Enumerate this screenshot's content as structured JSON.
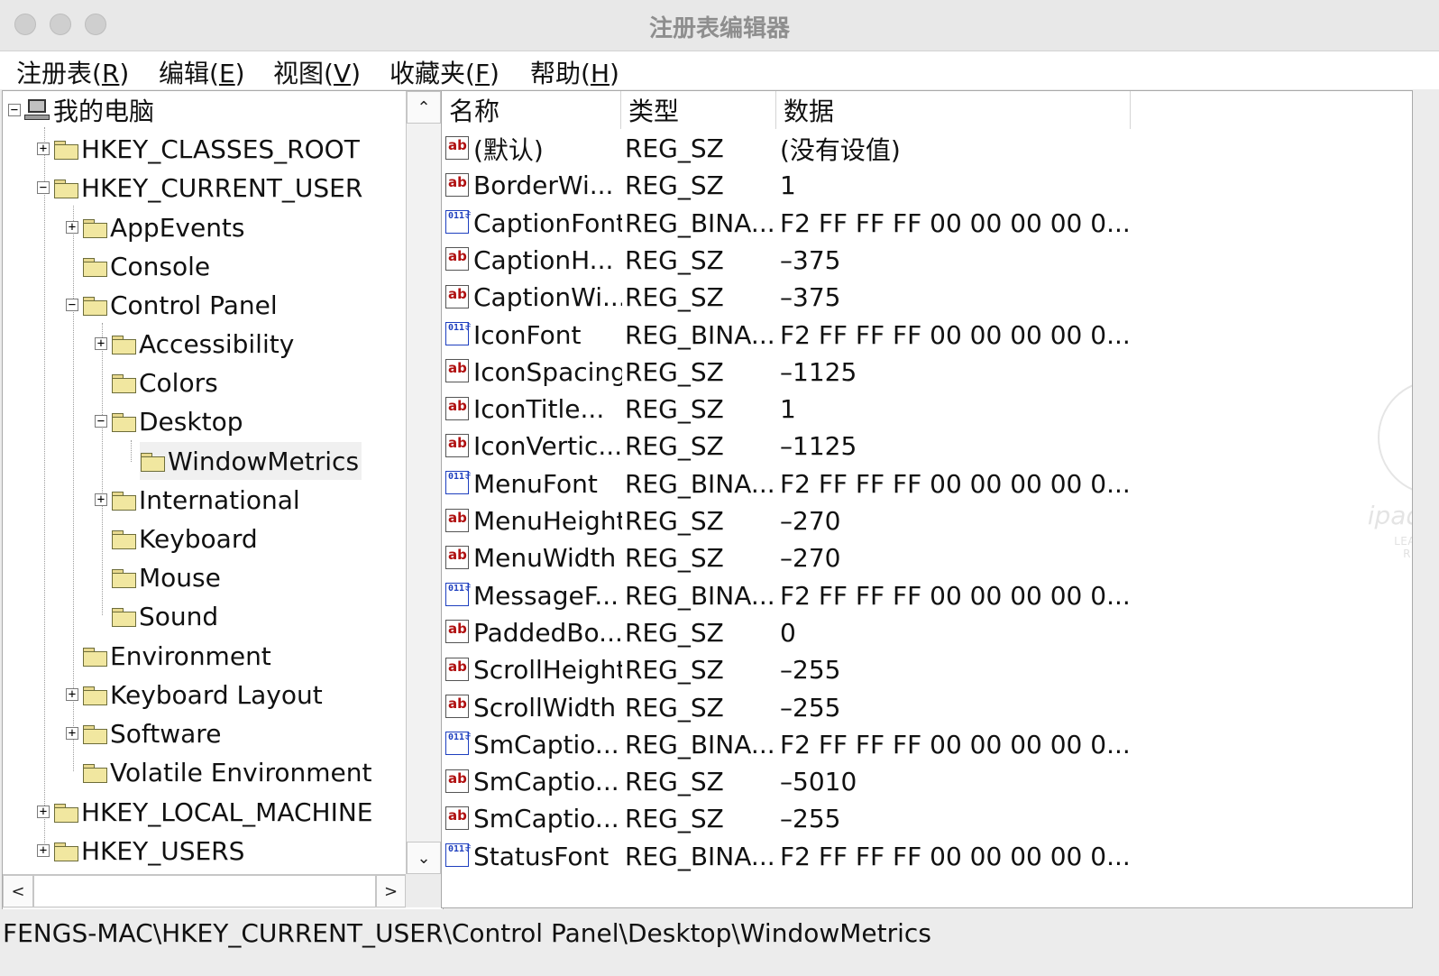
{
  "window": {
    "title": "注册表编辑器"
  },
  "menubar": {
    "items": [
      {
        "label": "注册表(",
        "key": "R",
        "suffix": ")"
      },
      {
        "label": "编辑(",
        "key": "E",
        "suffix": ")"
      },
      {
        "label": "视图(",
        "key": "V",
        "suffix": ")"
      },
      {
        "label": "收藏夹(",
        "key": "F",
        "suffix": ")"
      },
      {
        "label": "帮助(",
        "key": "H",
        "suffix": ")"
      }
    ]
  },
  "tree": {
    "root": "我的电脑",
    "nodes": [
      {
        "label": "HKEY_CLASSES_ROOT",
        "toggle": "+"
      },
      {
        "label": "HKEY_CURRENT_USER",
        "toggle": "−"
      },
      {
        "label": "AppEvents",
        "toggle": "+"
      },
      {
        "label": "Console",
        "toggle": ""
      },
      {
        "label": "Control Panel",
        "toggle": "−"
      },
      {
        "label": "Accessibility",
        "toggle": "+"
      },
      {
        "label": "Colors",
        "toggle": ""
      },
      {
        "label": "Desktop",
        "toggle": "−"
      },
      {
        "label": "WindowMetrics",
        "toggle": "",
        "selected": true
      },
      {
        "label": "International",
        "toggle": "+"
      },
      {
        "label": "Keyboard",
        "toggle": ""
      },
      {
        "label": "Mouse",
        "toggle": ""
      },
      {
        "label": "Sound",
        "toggle": ""
      },
      {
        "label": "Environment",
        "toggle": ""
      },
      {
        "label": "Keyboard Layout",
        "toggle": "+"
      },
      {
        "label": "Software",
        "toggle": "+"
      },
      {
        "label": "Volatile Environment",
        "toggle": ""
      },
      {
        "label": "HKEY_LOCAL_MACHINE",
        "toggle": "+"
      },
      {
        "label": "HKEY_USERS",
        "toggle": "+"
      }
    ],
    "scroll_up": "⌃",
    "scroll_down": "⌄",
    "scroll_left": "<",
    "scroll_right": ">"
  },
  "list": {
    "columns": {
      "name": "名称",
      "type": "类型",
      "data": "数据"
    },
    "rows": [
      {
        "name": "(默认)",
        "type": "REG_SZ",
        "data": "(没有设值)",
        "icon": "string-value-icon"
      },
      {
        "name": "BorderWi...",
        "type": "REG_SZ",
        "data": "1",
        "icon": "string-value-icon"
      },
      {
        "name": "CaptionFont",
        "type": "REG_BINA...",
        "data": "F2 FF FF FF 00 00 00 00 0...",
        "icon": "binary-value-icon"
      },
      {
        "name": "CaptionH...",
        "type": "REG_SZ",
        "data": "–375",
        "icon": "string-value-icon"
      },
      {
        "name": "CaptionWi...",
        "type": "REG_SZ",
        "data": "–375",
        "icon": "string-value-icon"
      },
      {
        "name": "IconFont",
        "type": "REG_BINA...",
        "data": "F2 FF FF FF 00 00 00 00 0...",
        "icon": "binary-value-icon"
      },
      {
        "name": "IconSpacing",
        "type": "REG_SZ",
        "data": "–1125",
        "icon": "string-value-icon"
      },
      {
        "name": "IconTitle...",
        "type": "REG_SZ",
        "data": "1",
        "icon": "string-value-icon"
      },
      {
        "name": "IconVertic...",
        "type": "REG_SZ",
        "data": "–1125",
        "icon": "string-value-icon"
      },
      {
        "name": "MenuFont",
        "type": "REG_BINA...",
        "data": "F2 FF FF FF 00 00 00 00 0...",
        "icon": "binary-value-icon"
      },
      {
        "name": "MenuHeight",
        "type": "REG_SZ",
        "data": "–270",
        "icon": "string-value-icon"
      },
      {
        "name": "MenuWidth",
        "type": "REG_SZ",
        "data": "–270",
        "icon": "string-value-icon"
      },
      {
        "name": "MessageF...",
        "type": "REG_BINA...",
        "data": "F2 FF FF FF 00 00 00 00 0...",
        "icon": "binary-value-icon"
      },
      {
        "name": "PaddedBo...",
        "type": "REG_SZ",
        "data": "0",
        "icon": "string-value-icon"
      },
      {
        "name": "ScrollHeight",
        "type": "REG_SZ",
        "data": "–255",
        "icon": "string-value-icon"
      },
      {
        "name": "ScrollWidth",
        "type": "REG_SZ",
        "data": "–255",
        "icon": "string-value-icon"
      },
      {
        "name": "SmCaptio...",
        "type": "REG_BINA...",
        "data": "F2 FF FF FF 00 00 00 00 0...",
        "icon": "binary-value-icon"
      },
      {
        "name": "SmCaptio...",
        "type": "REG_SZ",
        "data": "–5010",
        "icon": "string-value-icon"
      },
      {
        "name": "SmCaptio...",
        "type": "REG_SZ",
        "data": "–255",
        "icon": "string-value-icon"
      },
      {
        "name": "StatusFont",
        "type": "REG_BINA...",
        "data": "F2 FF FF FF 00 00 00 00 0...",
        "icon": "binary-value-icon"
      }
    ]
  },
  "statusbar": {
    "path": "FENGS-MAC\\HKEY_CURRENT_USER\\Control Panel\\Desktop\\WindowMetrics"
  },
  "watermark": {
    "letters": "IP",
    "host": "ipaddr.host",
    "tagline": "LEARNING AND RECORDING"
  }
}
